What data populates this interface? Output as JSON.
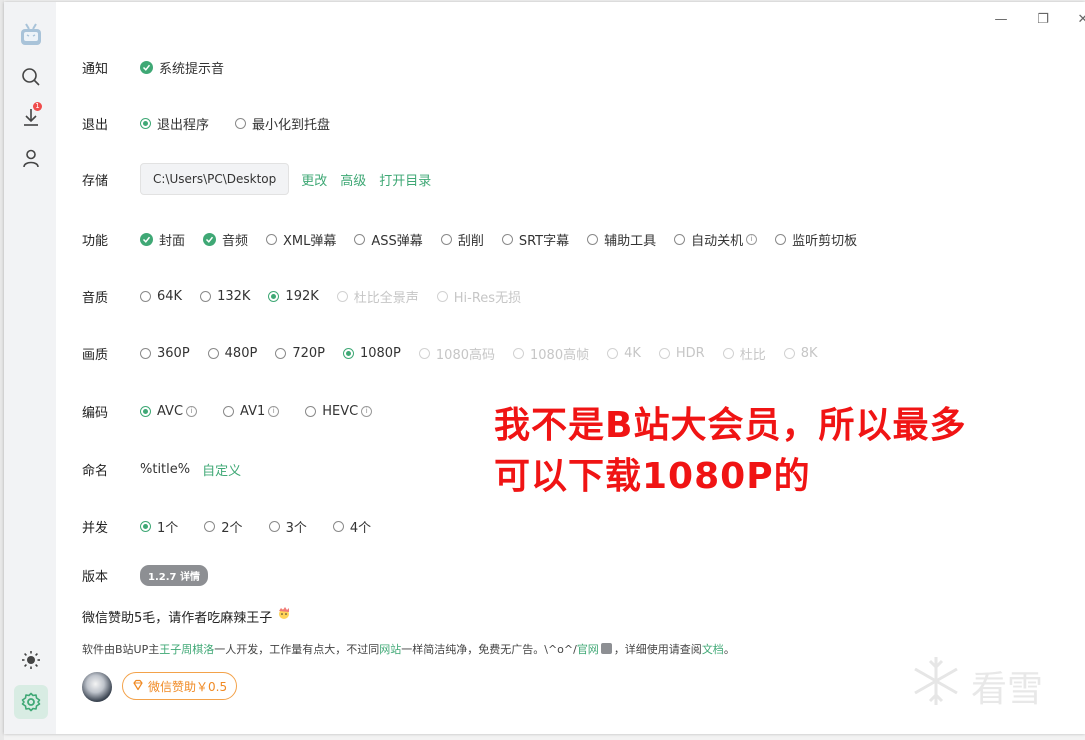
{
  "window": {
    "minimize_glyph": "—",
    "restore_glyph": "❐",
    "close_glyph": "✕"
  },
  "sidebar": {
    "icons": [
      "bilibili-tv-icon",
      "search-icon",
      "download-icon",
      "user-icon",
      "theme-sun-icon",
      "settings-gear-icon"
    ],
    "download_badge": "1"
  },
  "settings": {
    "notify": {
      "label": "通知",
      "options": [
        {
          "text": "系统提示音",
          "state": "checked"
        }
      ]
    },
    "exit": {
      "label": "退出",
      "options": [
        {
          "text": "退出程序",
          "state": "selected"
        },
        {
          "text": "最小化到托盘",
          "state": "unselected"
        }
      ]
    },
    "storage": {
      "label": "存储",
      "path": "C:\\Users\\PC\\Desktop",
      "links": [
        "更改",
        "高级",
        "打开目录"
      ]
    },
    "features": {
      "label": "功能",
      "options": [
        {
          "text": "封面",
          "state": "checked"
        },
        {
          "text": "音频",
          "state": "checked"
        },
        {
          "text": "XML弹幕",
          "state": "unselected"
        },
        {
          "text": "ASS弹幕",
          "state": "unselected"
        },
        {
          "text": "刮削",
          "state": "unselected"
        },
        {
          "text": "SRT字幕",
          "state": "unselected"
        },
        {
          "text": "辅助工具",
          "state": "unselected"
        },
        {
          "text": "自动关机",
          "state": "unselected",
          "info": "i"
        },
        {
          "text": "监听剪切板",
          "state": "unselected"
        }
      ]
    },
    "audio_quality": {
      "label": "音质",
      "options": [
        {
          "text": "64K",
          "state": "unselected"
        },
        {
          "text": "132K",
          "state": "unselected"
        },
        {
          "text": "192K",
          "state": "selected"
        },
        {
          "text": "杜比全景声",
          "state": "disabled"
        },
        {
          "text": "Hi-Res无损",
          "state": "disabled"
        }
      ]
    },
    "video_quality": {
      "label": "画质",
      "options": [
        {
          "text": "360P",
          "state": "unselected"
        },
        {
          "text": "480P",
          "state": "unselected"
        },
        {
          "text": "720P",
          "state": "unselected"
        },
        {
          "text": "1080P",
          "state": "selected"
        },
        {
          "text": "1080高码",
          "state": "disabled"
        },
        {
          "text": "1080高帧",
          "state": "disabled"
        },
        {
          "text": "4K",
          "state": "disabled"
        },
        {
          "text": "HDR",
          "state": "disabled"
        },
        {
          "text": "杜比",
          "state": "disabled"
        },
        {
          "text": "8K",
          "state": "disabled"
        }
      ]
    },
    "codec": {
      "label": "编码",
      "options": [
        {
          "text": "AVC",
          "state": "selected",
          "info": "i"
        },
        {
          "text": "AV1",
          "state": "unselected",
          "info": "i"
        },
        {
          "text": "HEVC",
          "state": "unselected",
          "info": "i"
        }
      ]
    },
    "naming": {
      "label": "命名",
      "value": "%title%",
      "link": "自定义"
    },
    "concurrency": {
      "label": "并发",
      "options": [
        {
          "text": "1个",
          "state": "selected"
        },
        {
          "text": "2个",
          "state": "unselected"
        },
        {
          "text": "3个",
          "state": "unselected"
        },
        {
          "text": "4个",
          "state": "unselected"
        }
      ]
    },
    "version": {
      "label": "版本",
      "badge": "1.2.7 详情"
    }
  },
  "footer": {
    "donate_line": "微信赞助5毛，请作者吃麻辣王子",
    "about_parts": [
      {
        "text": "软件由B站UP主",
        "link": false
      },
      {
        "text": "王子周棋洛",
        "link": true
      },
      {
        "text": "一人开发，工作量有点大，不过同",
        "link": false
      },
      {
        "text": "网站",
        "link": true
      },
      {
        "text": "一样简洁纯净，免费无广告。\\^o^/",
        "link": false
      },
      {
        "text": "官网",
        "link": true
      },
      {
        "text": "，详细使用请查阅",
        "link": false
      },
      {
        "text": "文档",
        "link": true
      },
      {
        "text": "。",
        "link": false
      }
    ],
    "donate_button": "微信赞助￥0.5"
  },
  "annotation": {
    "line1": "我不是B站大会员，所以最多",
    "line2": "可以下载1080P的"
  },
  "watermark": {
    "text": "看雪"
  },
  "colors": {
    "accent": "#3fa875",
    "annotation": "#f01414",
    "donate": "#f08a24"
  }
}
